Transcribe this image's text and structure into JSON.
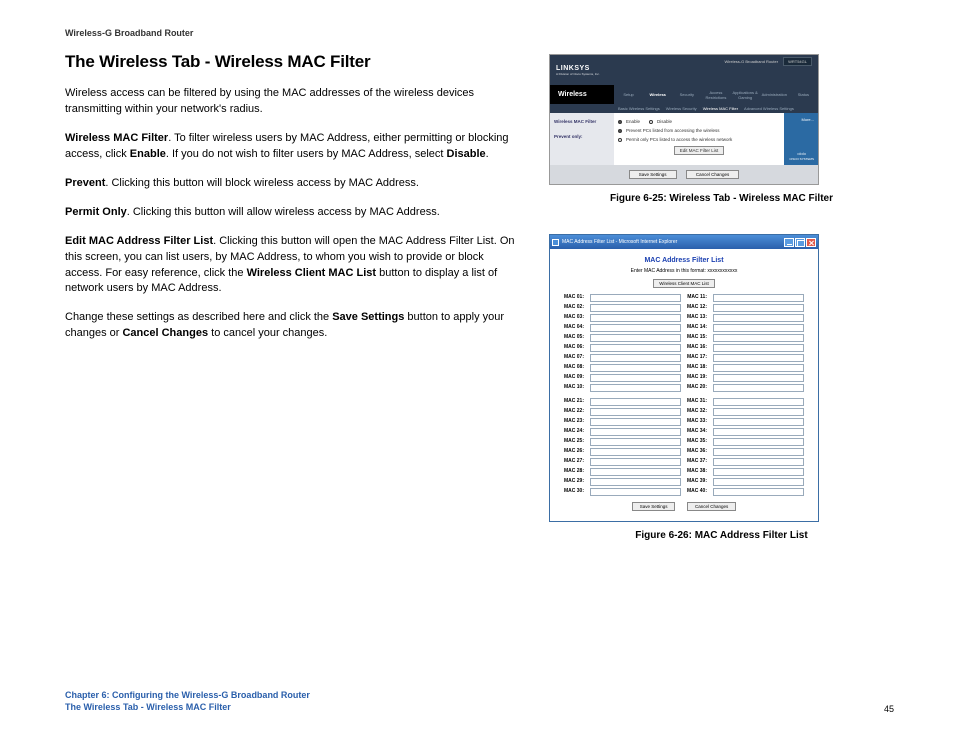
{
  "header": "Wireless-G Broadband Router",
  "title": "The Wireless Tab - Wireless MAC Filter",
  "para1": "Wireless access can be filtered by using the MAC addresses of the wireless devices transmitting within your network's radius.",
  "p2_b1": "Wireless MAC Filter",
  "p2_t1": ". To filter wireless users by MAC Address, either permitting or blocking access, click ",
  "p2_b2": "Enable",
  "p2_t2": ". If you do not wish to filter users by MAC Address, select ",
  "p2_b3": "Disable",
  "p2_t3": ".",
  "p3_b": "Prevent",
  "p3_t": ". Clicking this button will block wireless access by MAC Address.",
  "p4_b": "Permit Only",
  "p4_t": ". Clicking this button will allow wireless access by MAC Address.",
  "p5_b1": "Edit MAC Address Filter List",
  "p5_t1": ". Clicking this button will open the MAC Address Filter List. On this screen, you can list users, by MAC Address, to whom you wish to provide or block access. For easy reference, click the ",
  "p5_b2": "Wireless Client MAC List",
  "p5_t2": " button to display a list of network users by MAC Address.",
  "p6_t1": "Change these settings as described here and click the ",
  "p6_b1": "Save Settings",
  "p6_t2": " button to apply your changes or ",
  "p6_b2": "Cancel Changes",
  "p6_t3": " to cancel your changes.",
  "fig1_caption": "Figure 6-25: Wireless Tab - Wireless MAC Filter",
  "fig2_caption": "Figure 6-26: MAC Address Filter List",
  "router": {
    "brand": "LINKSYS",
    "brand_sub": "A Division of Cisco Systems, Inc.",
    "model_label": "Wireless-G Broadband Router",
    "model_code": "WRT54GL",
    "section": "Wireless",
    "tabs": [
      "Setup",
      "Wireless",
      "Security",
      "Access Restrictions",
      "Applications & Gaming",
      "Administration",
      "Status"
    ],
    "subtabs": [
      "Basic Wireless Settings",
      "Wireless Security",
      "Wireless MAC Filter",
      "Advanced Wireless Settings"
    ],
    "side_label1": "Wireless MAC Filter",
    "side_label2": "Prevent only:",
    "opt_enable": "Enable",
    "opt_disable": "Disable",
    "opt_prevent": "Prevent PCs listed from accessing the wireless",
    "opt_permit": "Permit only PCs listed to access the wireless network",
    "btn_edit": "Edit MAC Filter List",
    "btn_save": "Save Settings",
    "btn_cancel": "Cancel Changes",
    "side_panel": "More...",
    "cisco": "CISCO SYSTEMS"
  },
  "macwin": {
    "titlebar": "MAC Address Filter List - Microsoft Internet Explorer",
    "heading": "MAC Address Filter List",
    "sub": "Enter MAC Address in this format: xxxxxxxxxxxx",
    "btn_wclist": "Wireless Client MAC List",
    "rows_a": [
      "MAC 01:",
      "MAC 02:",
      "MAC 03:",
      "MAC 04:",
      "MAC 05:",
      "MAC 06:",
      "MAC 07:",
      "MAC 08:",
      "MAC 09:",
      "MAC 10:"
    ],
    "rows_b": [
      "MAC 11:",
      "MAC 12:",
      "MAC 13:",
      "MAC 14:",
      "MAC 15:",
      "MAC 16:",
      "MAC 17:",
      "MAC 18:",
      "MAC 19:",
      "MAC 20:"
    ],
    "rows_c": [
      "MAC 21:",
      "MAC 22:",
      "MAC 23:",
      "MAC 24:",
      "MAC 25:",
      "MAC 26:",
      "MAC 27:",
      "MAC 28:",
      "MAC 29:",
      "MAC 30:"
    ],
    "rows_d": [
      "MAC 31:",
      "MAC 32:",
      "MAC 33:",
      "MAC 34:",
      "MAC 35:",
      "MAC 36:",
      "MAC 37:",
      "MAC 38:",
      "MAC 39:",
      "MAC 40:"
    ],
    "btn_save": "Save Settings",
    "btn_cancel": "Cancel Changes"
  },
  "footer": {
    "chapter": "Chapter 6: Configuring the Wireless-G Broadband Router",
    "section": "The Wireless Tab - Wireless MAC Filter",
    "page": "45"
  }
}
